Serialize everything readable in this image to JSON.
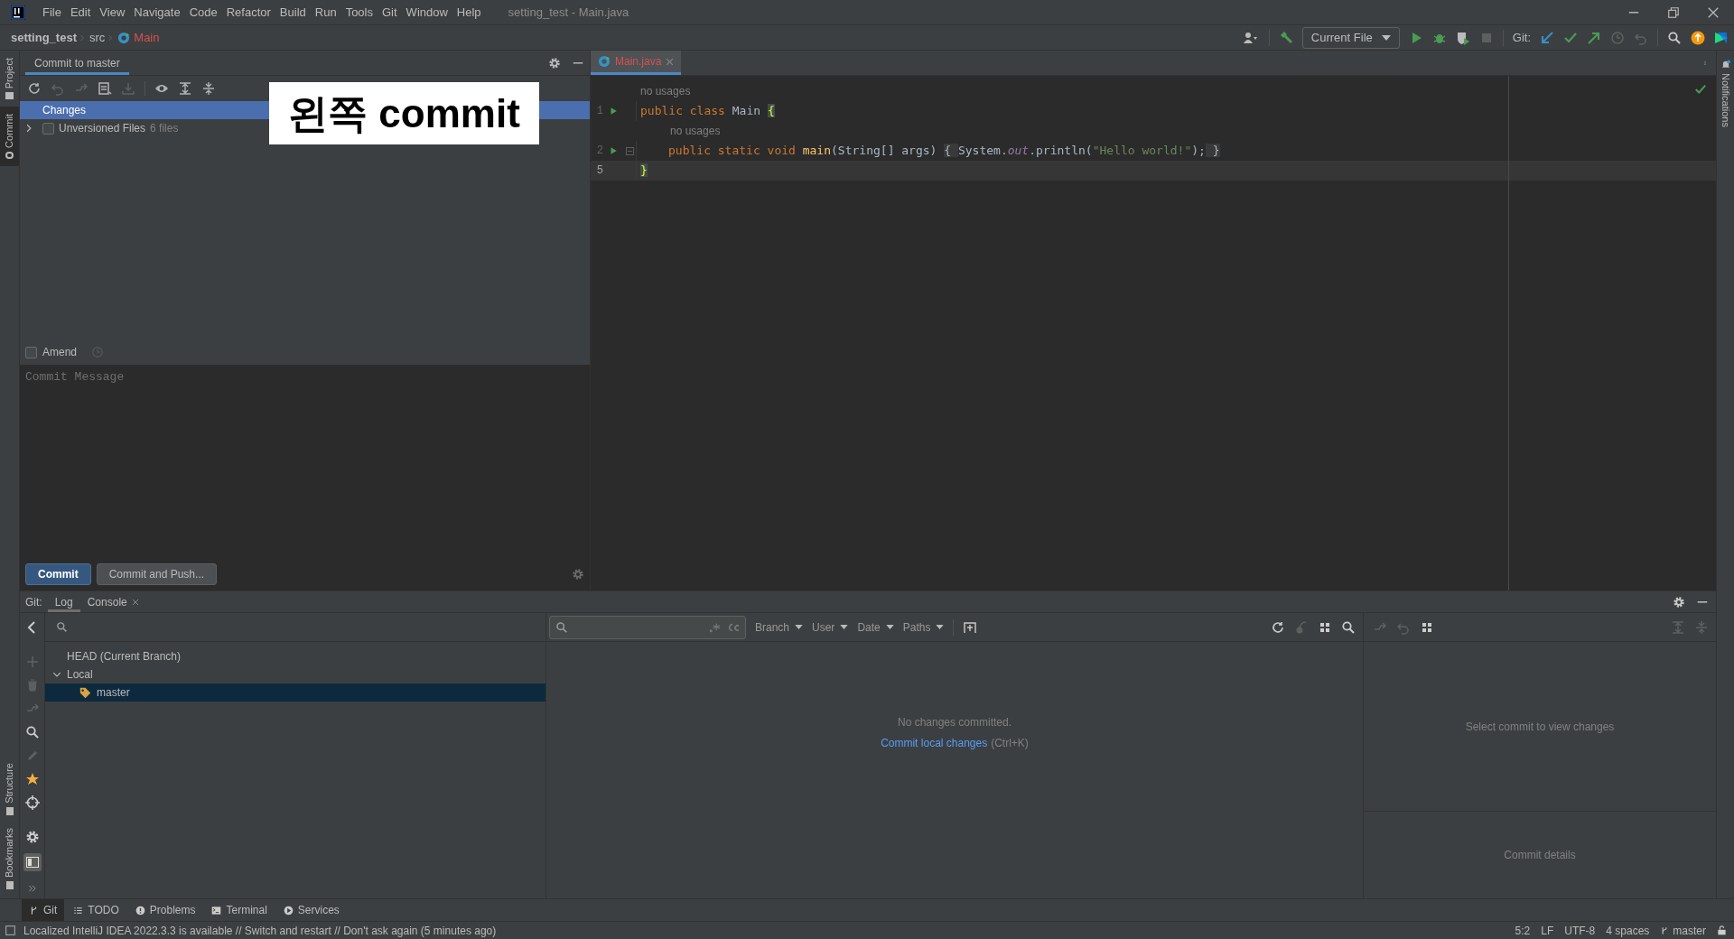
{
  "window": {
    "title": "setting_test - Main.java"
  },
  "menu": [
    "File",
    "Edit",
    "View",
    "Navigate",
    "Code",
    "Refactor",
    "Build",
    "Run",
    "Tools",
    "Git",
    "Window",
    "Help"
  ],
  "breadcrumbs": [
    {
      "label": "setting_test",
      "kind": "project"
    },
    {
      "label": "src",
      "kind": "folder"
    },
    {
      "label": "Main",
      "kind": "class"
    }
  ],
  "toolbar": {
    "run_config": "Current File",
    "git_label": "Git:"
  },
  "left_stripe": [
    {
      "label": "Project",
      "selected": false
    },
    {
      "label": "Commit",
      "selected": true
    }
  ],
  "left_stripe_bottom": [
    {
      "label": "Structure"
    },
    {
      "label": "Bookmarks"
    }
  ],
  "right_stripe": [
    {
      "label": "Notifications"
    }
  ],
  "commit_panel": {
    "tab": "Commit to master",
    "tree": [
      {
        "label": "Changes",
        "kind": "group",
        "selected": true
      },
      {
        "label": "Unversioned Files",
        "count": "6 files",
        "kind": "folder",
        "selected": false,
        "expanded": false,
        "checked": false
      }
    ],
    "amend": {
      "label": "Amend",
      "checked": false
    },
    "message": {
      "placeholder": "Commit Message"
    },
    "buttons": [
      {
        "label": "Commit",
        "kind": "primary"
      },
      {
        "label": "Commit and Push...",
        "kind": "secondary"
      }
    ]
  },
  "annotation": "왼쪽 commit",
  "editor": {
    "tabs": [
      {
        "label": "Main.java",
        "selected": true
      }
    ],
    "lines": [
      {
        "kind": "hint",
        "indent": false,
        "text": "no usages"
      },
      {
        "kind": "code",
        "number": "1",
        "run": true,
        "fold": false,
        "current": false,
        "indent": false,
        "tokens": [
          {
            "kind": "keyword",
            "text": "public class "
          },
          {
            "kind": "plain",
            "text": "Main "
          },
          {
            "kind": "brace",
            "text": "{"
          }
        ]
      },
      {
        "kind": "hint",
        "indent": true,
        "text": "no usages"
      },
      {
        "kind": "code",
        "number": "2",
        "run": true,
        "fold": true,
        "current": false,
        "indent": true,
        "tokens": [
          {
            "kind": "keyword",
            "text": "public static void "
          },
          {
            "kind": "method",
            "text": "main"
          },
          {
            "kind": "plain",
            "text": "(String[] args) "
          },
          {
            "kind": "folded",
            "text": "{ "
          },
          {
            "kind": "plain",
            "text": "System."
          },
          {
            "kind": "field",
            "text": "out"
          },
          {
            "kind": "plain",
            "text": ".println("
          },
          {
            "kind": "string",
            "text": "\"Hello world!\""
          },
          {
            "kind": "plain",
            "text": ");"
          },
          {
            "kind": "folded",
            "text": " }"
          }
        ]
      },
      {
        "kind": "code",
        "number": "5",
        "run": false,
        "fold": false,
        "current": true,
        "indent": false,
        "tokens": [
          {
            "kind": "brace",
            "text": "}"
          }
        ]
      }
    ]
  },
  "git_window": {
    "label": "Git:",
    "tabs": [
      {
        "label": "Log",
        "selected": true,
        "closable": false
      },
      {
        "label": "Console",
        "selected": false,
        "closable": true
      }
    ],
    "branches": [
      {
        "label": "HEAD (Current Branch)",
        "selected": false
      },
      {
        "label": "Local",
        "selected": false,
        "expanded": true,
        "children": [
          {
            "label": "master",
            "selected": true
          }
        ]
      }
    ],
    "filters": [
      "Branch",
      "User",
      "Date",
      "Paths"
    ],
    "empty_text": "No changes committed.",
    "empty_link": "Commit local changes",
    "empty_shortcut": "(Ctrl+K)",
    "changes_hint": "Select commit to view changes",
    "details_hint": "Commit details"
  },
  "bottom_tabs": [
    {
      "label": "Git",
      "kind": "branch",
      "selected": true
    },
    {
      "label": "TODO",
      "kind": "list",
      "selected": false
    },
    {
      "label": "Problems",
      "kind": "info",
      "selected": false
    },
    {
      "label": "Terminal",
      "kind": "terminal",
      "selected": false
    },
    {
      "label": "Services",
      "kind": "play",
      "selected": false
    }
  ],
  "status_bar": {
    "message": "Localized IntelliJ IDEA 2022.3.3 is available // Switch and restart // Don't ask again (5 minutes ago)",
    "position": "5:2",
    "line_separator": "LF",
    "encoding": "UTF-8",
    "indent": "4 spaces",
    "branch": "master"
  }
}
